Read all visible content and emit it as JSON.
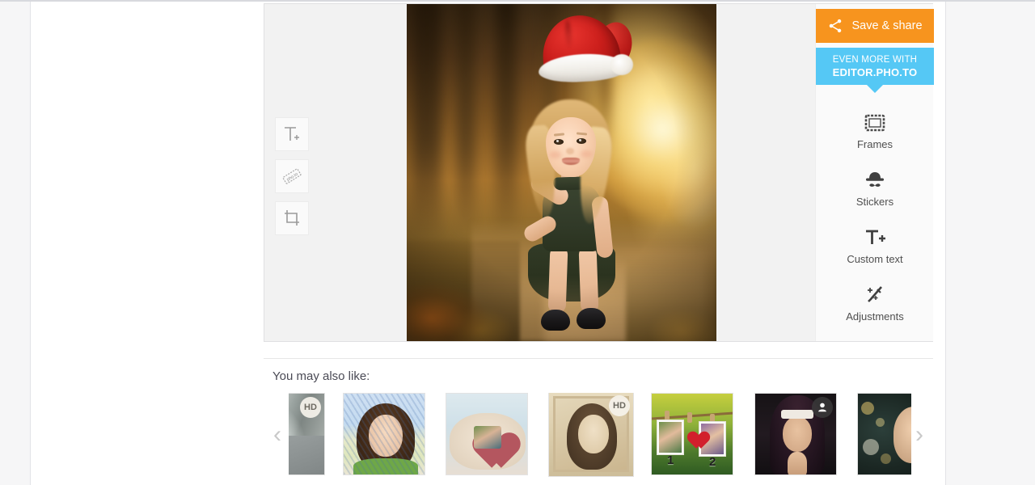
{
  "editor": {
    "left_tools": [
      {
        "name": "add-text",
        "icon": "text-plus-icon",
        "title": "Add text"
      },
      {
        "name": "watermark",
        "icon": "photo-label-icon",
        "title": "Watermark",
        "label": "pho.to"
      },
      {
        "name": "crop",
        "icon": "crop-icon",
        "title": "Crop"
      }
    ],
    "sidebar": {
      "save_share_label": "Save & share",
      "save_share_icon": "share-icon",
      "save_share_color": "#f7941e",
      "promo": {
        "line1": "EVEN MORE WITH",
        "line2": "EDITOR.PHO.TO",
        "color": "#55c8f5"
      },
      "tools": [
        {
          "label": "Frames",
          "icon": "frame-icon"
        },
        {
          "label": "Stickers",
          "icon": "hat-mustache-icon"
        },
        {
          "label": "Custom text",
          "icon": "text-plus-icon"
        },
        {
          "label": "Adjustments",
          "icon": "magic-wand-icon"
        }
      ]
    },
    "photo": {
      "alt": "Girl in a Santa hat standing on a forest path at sunset"
    }
  },
  "suggestions": {
    "title": "You may also like:",
    "prev_arrow": "‹",
    "next_arrow": "›",
    "items": [
      {
        "name": "thumb-street-blur",
        "badge": "HD",
        "badge_type": "hd"
      },
      {
        "name": "thumb-pencil-sketch",
        "badge": "",
        "badge_type": "none"
      },
      {
        "name": "thumb-heart-mittens",
        "badge": "",
        "badge_type": "none"
      },
      {
        "name": "thumb-vintage-sepia",
        "badge": "HD",
        "badge_type": "hd"
      },
      {
        "name": "thumb-clothesline-two-photos",
        "badge": "",
        "badge_type": "none",
        "card1": "1",
        "card2": "2"
      },
      {
        "name": "thumb-nun-portrait",
        "badge": "person",
        "badge_type": "person"
      },
      {
        "name": "thumb-bokeh-lights",
        "badge": "",
        "badge_type": "none"
      }
    ]
  }
}
